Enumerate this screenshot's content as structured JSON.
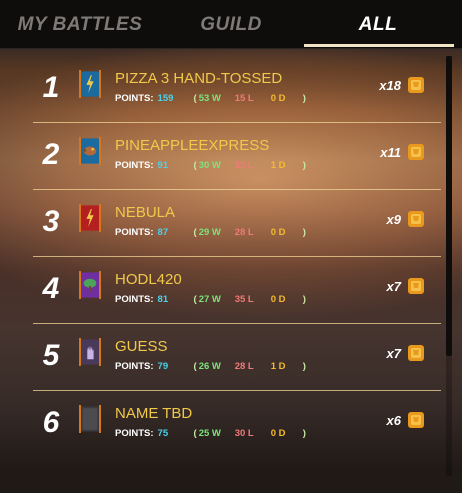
{
  "tabs": [
    {
      "label": "MY BATTLES",
      "active": false
    },
    {
      "label": "GUILD",
      "active": false
    },
    {
      "label": "ALL",
      "active": true
    }
  ],
  "points_label": "POINTS:",
  "guilds": [
    {
      "rank": "1",
      "name": "PIZZA 3 HAND-TOSSED",
      "points": "159",
      "paren_open": "(",
      "wins": "53 W",
      "losses": "15 L",
      "draws": "0 D",
      "paren_close": ")",
      "multiplier": "x18",
      "banner_icon": "lightning-icon",
      "banner_color": "#1b6aa0"
    },
    {
      "rank": "2",
      "name": "PINEAPPLEEXPRESS",
      "points": "91",
      "paren_open": "(",
      "wins": "30 W",
      "losses": "35 L",
      "draws": "1 D",
      "paren_close": ")",
      "multiplier": "x11",
      "banner_icon": "creature-icon",
      "banner_color": "#1b6aa0"
    },
    {
      "rank": "3",
      "name": "NEBULA",
      "points": "87",
      "paren_open": "(",
      "wins": "29 W",
      "losses": "28 L",
      "draws": "0 D",
      "paren_close": ")",
      "multiplier": "x9",
      "banner_icon": "lightning-icon",
      "banner_color": "#b3201f"
    },
    {
      "rank": "4",
      "name": "HODL420",
      "points": "81",
      "paren_open": "(",
      "wins": "27 W",
      "losses": "35 L",
      "draws": "0 D",
      "paren_close": ")",
      "multiplier": "x7",
      "banner_icon": "tree-icon",
      "banner_color": "#6f2fa0"
    },
    {
      "rank": "5",
      "name": "GUESS",
      "points": "79",
      "paren_open": "(",
      "wins": "26 W",
      "losses": "28 L",
      "draws": "1 D",
      "paren_close": ")",
      "multiplier": "x7",
      "banner_icon": "hand-icon",
      "banner_color": "#4a3a5a"
    },
    {
      "rank": "6",
      "name": "NAME TBD",
      "points": "75",
      "paren_open": "(",
      "wins": "25 W",
      "losses": "30 L",
      "draws": "0 D",
      "paren_close": ")",
      "multiplier": "x6",
      "banner_icon": "blank-banner-icon",
      "banner_color": "#3a3a3e"
    }
  ],
  "colors": {
    "accent_gold": "#f1c94a",
    "points": "#4ad2ec",
    "wins": "#7de37a",
    "losses": "#f07a7a",
    "draws": "#f5bb2e"
  }
}
